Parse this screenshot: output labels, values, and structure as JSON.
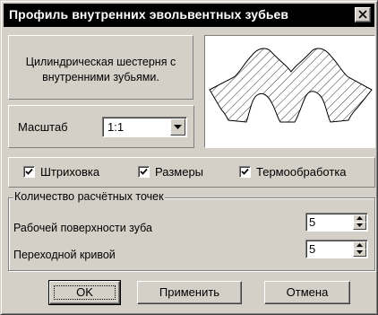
{
  "window": {
    "title": "Профиль внутренних эвольвентных зубьев",
    "close_glyph": "×"
  },
  "description": {
    "line1": "Цилиндрическая шестерня с",
    "line2": "внутренними зубьями."
  },
  "scale": {
    "label": "Масштаб",
    "value": "1:1"
  },
  "options": {
    "hatching": {
      "label": "Штриховка",
      "checked": true
    },
    "dimensions": {
      "label": "Размеры",
      "checked": true
    },
    "heat_treatment": {
      "label": "Термообработка",
      "checked": true
    }
  },
  "points": {
    "legend": "Количество расчётных точек",
    "working_surface": {
      "label": "Рабочей поверхности зуба",
      "value": "5"
    },
    "transition_curve": {
      "label": "Переходной кривой",
      "value": "5"
    }
  },
  "buttons": {
    "ok": "OK",
    "apply": "Применить",
    "cancel": "Отмена"
  },
  "icons": {
    "close": "close-icon",
    "dropdown": "chevron-down-icon",
    "checkmark": "checkmark-icon",
    "spin_up": "spin-up-icon",
    "spin_down": "spin-down-icon"
  },
  "colors": {
    "face": "#d4d0c8",
    "titlebar": "#000000",
    "title_text": "#ffffff",
    "preview_bg": "#ffffff"
  }
}
